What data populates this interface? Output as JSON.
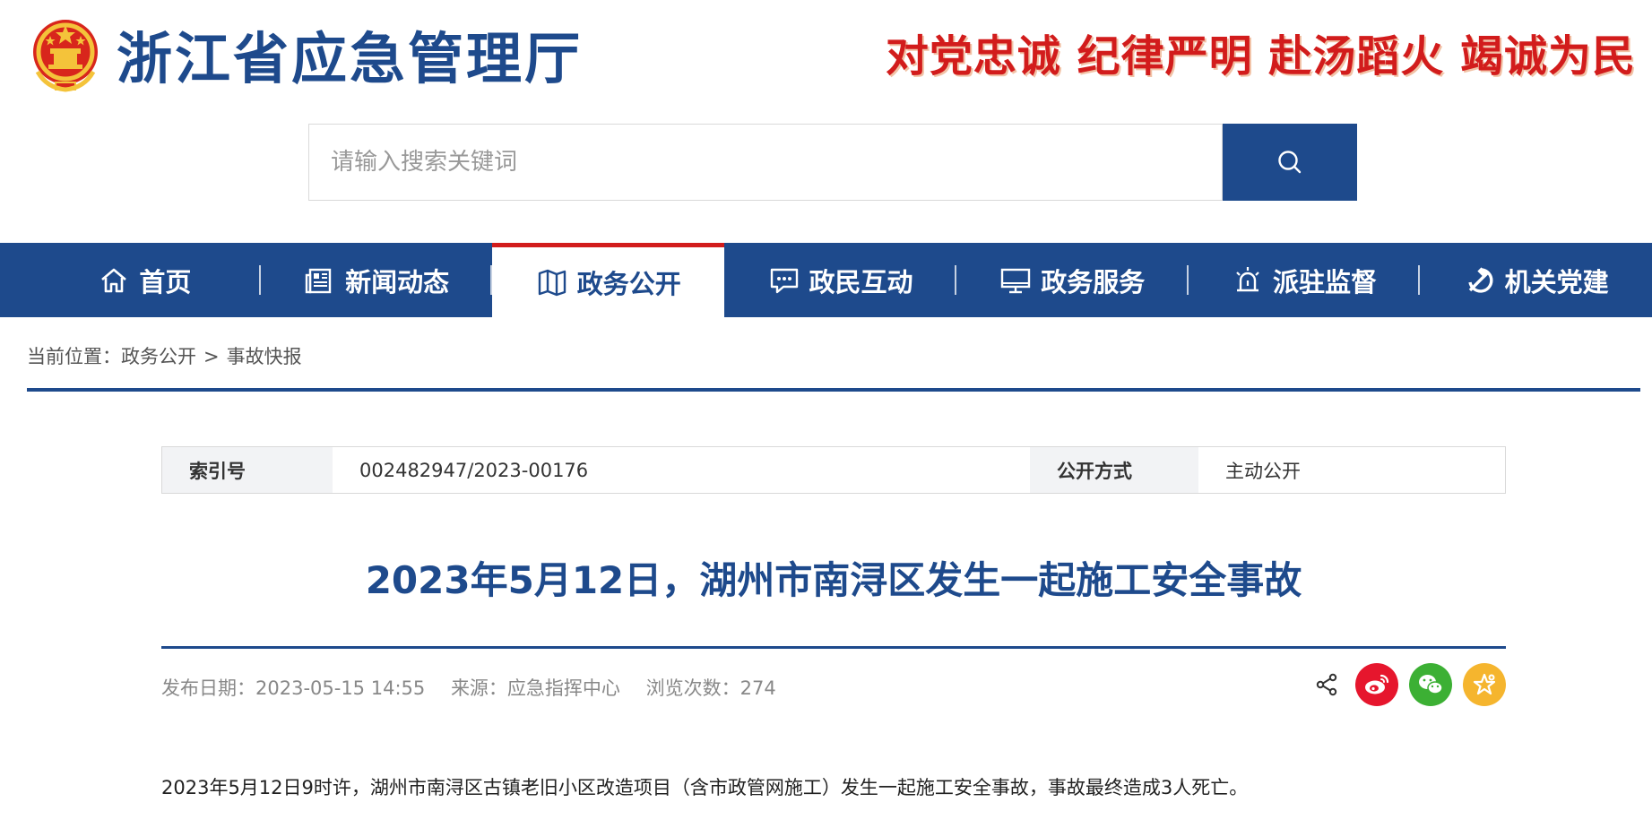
{
  "header": {
    "site_title": "浙江省应急管理厅",
    "slogan": "对党忠诚 纪律严明 赴汤蹈火 竭诚为民",
    "emblem_icon": "national-emblem-icon"
  },
  "search": {
    "placeholder": "请输入搜索关键词",
    "value": "",
    "button_icon": "search-icon"
  },
  "nav": {
    "items": [
      {
        "label": "首页",
        "icon": "home-icon"
      },
      {
        "label": "新闻动态",
        "icon": "newspaper-icon"
      },
      {
        "label": "政务公开",
        "icon": "book-open-icon",
        "active": true
      },
      {
        "label": "政民互动",
        "icon": "chat-bubble-icon"
      },
      {
        "label": "政务服务",
        "icon": "monitor-icon"
      },
      {
        "label": "派驻监督",
        "icon": "alarm-light-icon"
      },
      {
        "label": "机关党建",
        "icon": "hammer-sickle-icon"
      }
    ]
  },
  "breadcrumb": {
    "prefix": "当前位置：",
    "items": [
      "政务公开",
      "事故快报"
    ],
    "separator": ">"
  },
  "meta": {
    "index_label": "索引号",
    "index_value": "002482947/2023-00176",
    "disclosure_label": "公开方式",
    "disclosure_value": "主动公开"
  },
  "article": {
    "title": "2023年5月12日，湖州市南浔区发生一起施工安全事故",
    "publish_date": "发布日期：2023-05-15 14:55",
    "source": "来源：应急指挥中心",
    "views": "浏览次数：274",
    "body": "2023年5月12日9时许，湖州市南浔区古镇老旧小区改造项目（含市政管网施工）发生一起施工安全事故，事故最终造成3人死亡。"
  },
  "share": {
    "items": [
      {
        "icon": "share-icon"
      },
      {
        "icon": "weibo-icon",
        "color": "#e6162d"
      },
      {
        "icon": "wechat-icon",
        "color": "#3cb034"
      },
      {
        "icon": "favorite-star-icon",
        "color": "#f5b52e"
      }
    ]
  },
  "colors": {
    "primary": "#1e4a8c",
    "accent_red": "#d21c1c"
  }
}
